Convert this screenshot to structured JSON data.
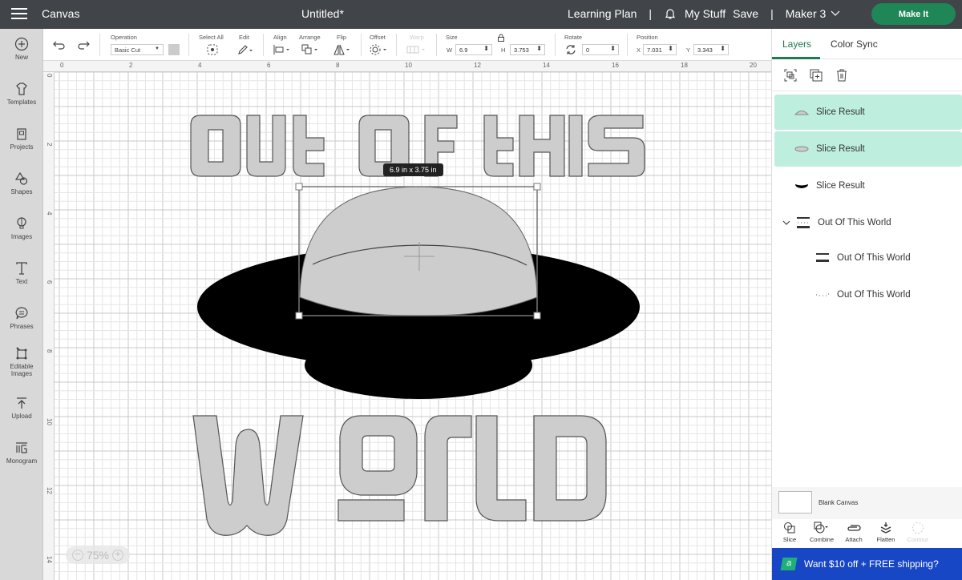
{
  "topbar": {
    "app_title": "Canvas",
    "doc_title": "Untitled*",
    "learning_plan": "Learning Plan",
    "separator": "|",
    "my_stuff": "My Stuff",
    "save": "Save",
    "machine": "Maker 3",
    "make_it": "Make It",
    "make_it_color": "#1f8656"
  },
  "sidebar": {
    "items": [
      {
        "label": "New",
        "icon": "plus-circle-icon"
      },
      {
        "label": "Templates",
        "icon": "shirt-icon"
      },
      {
        "label": "Projects",
        "icon": "projects-icon"
      },
      {
        "label": "Shapes",
        "icon": "shapes-icon"
      },
      {
        "label": "Images",
        "icon": "lightbulb-icon"
      },
      {
        "label": "Text",
        "icon": "text-icon"
      },
      {
        "label": "Phrases",
        "icon": "speech-bubble-icon"
      },
      {
        "label": "Editable",
        "label2": "Images",
        "icon": "editable-images-icon"
      },
      {
        "label": "Upload",
        "icon": "upload-icon"
      },
      {
        "label": "Monogram",
        "icon": "monogram-icon"
      }
    ]
  },
  "toolbar": {
    "operation_label": "Operation",
    "operation_value": "Basic Cut",
    "select_all": "Select All",
    "edit": "Edit",
    "align": "Align",
    "arrange": "Arrange",
    "flip": "Flip",
    "offset": "Offset",
    "warp": "Warp",
    "size_label": "Size",
    "w_label": "W",
    "w_value": "6.9",
    "h_label": "H",
    "h_value": "3.753",
    "rotate_label": "Rotate",
    "rotate_value": "0",
    "position_label": "Position",
    "x_label": "X",
    "x_value": "7.031",
    "y_label": "Y",
    "y_value": "3.343"
  },
  "canvas": {
    "h_ruler": [
      "0",
      "2",
      "4",
      "6",
      "8",
      "10",
      "12",
      "14",
      "16",
      "18",
      "20"
    ],
    "v_ruler": [
      "0",
      "2",
      "4",
      "6",
      "8",
      "10",
      "12",
      "14"
    ],
    "dimension_tooltip": "6.9  in x 3.75  in",
    "zoom_level": "75%",
    "zoom_out": "−",
    "zoom_in": "+",
    "text_top": "OUT OF THIS",
    "text_bottom": "WORLD"
  },
  "panel": {
    "tabs": [
      {
        "label": "Layers",
        "active": true
      },
      {
        "label": "Color Sync",
        "active": false
      }
    ],
    "layers": [
      {
        "name": "Slice Result",
        "selected": true,
        "thumb": "dome-top-thumb"
      },
      {
        "name": "Slice Result",
        "selected": true,
        "thumb": "dome-mid-thumb"
      },
      {
        "name": "Slice Result",
        "selected": false,
        "thumb": "saucer-thumb"
      },
      {
        "name": "Out Of This World",
        "selected": false,
        "thumb": "group-thumb",
        "group": true
      },
      {
        "name": "Out Of This World",
        "selected": false,
        "thumb": "text-thumb"
      },
      {
        "name": "Out Of This World",
        "selected": false,
        "thumb": "dots-thumb"
      }
    ],
    "blank_canvas": "Blank Canvas",
    "actions": [
      {
        "label": "Slice",
        "enabled": true
      },
      {
        "label": "Combine",
        "enabled": true
      },
      {
        "label": "Attach",
        "enabled": true
      },
      {
        "label": "Flatten",
        "enabled": true
      },
      {
        "label": "Contour",
        "enabled": false
      }
    ],
    "promo": "Want $10 off + FREE shipping?",
    "promo_badge": "a",
    "accent": "#1f7a50",
    "selected_bg": "#bdeede"
  }
}
